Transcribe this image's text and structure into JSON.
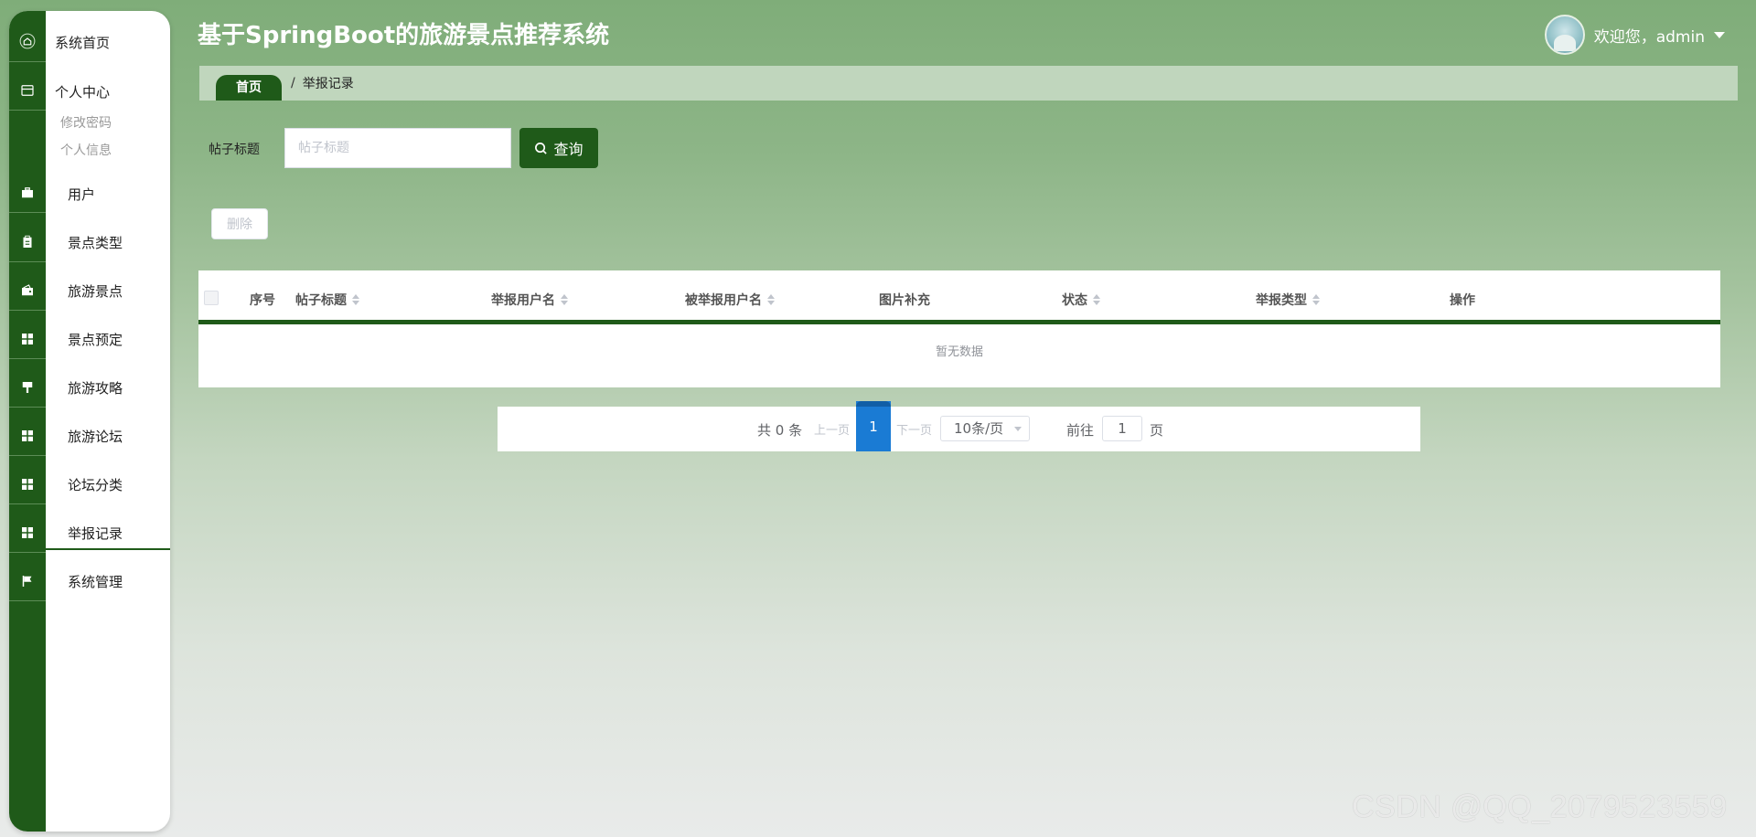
{
  "header": {
    "title": "基于SpringBoot的旅游景点推荐系统",
    "user_greeting": "欢迎您，admin"
  },
  "sidebar": {
    "items": [
      {
        "label": "系统首页",
        "icon": "home-icon"
      },
      {
        "label": "个人中心",
        "icon": "card-icon"
      },
      {
        "label": "修改密码"
      },
      {
        "label": "个人信息"
      },
      {
        "label": "用户",
        "icon": "briefcase-icon"
      },
      {
        "label": "景点类型",
        "icon": "clipboard-icon"
      },
      {
        "label": "旅游景点",
        "icon": "wallet-icon"
      },
      {
        "label": "景点预定",
        "icon": "grid-icon"
      },
      {
        "label": "旅游攻略",
        "icon": "brush-icon"
      },
      {
        "label": "旅游论坛",
        "icon": "grid-icon"
      },
      {
        "label": "论坛分类",
        "icon": "grid-icon"
      },
      {
        "label": "举报记录",
        "icon": "grid-icon"
      },
      {
        "label": "系统管理",
        "icon": "flag-icon"
      }
    ]
  },
  "breadcrumb": {
    "home": "首页",
    "separator": "/",
    "current": "举报记录"
  },
  "search": {
    "label": "帖子标题",
    "placeholder": "帖子标题",
    "value": "",
    "button": "查询"
  },
  "actions": {
    "delete": "删除"
  },
  "table": {
    "columns": [
      "序号",
      "帖子标题",
      "举报用户名",
      "被举报用户名",
      "图片补充",
      "状态",
      "举报类型",
      "操作"
    ],
    "rows": [],
    "empty_text": "暂无数据"
  },
  "pagination": {
    "total": "共 0 条",
    "prev": "上一页",
    "current_page": "1",
    "next": "下一页",
    "page_size": "10条/页",
    "goto_label": "前往",
    "goto_value": "1",
    "goto_suffix": "页"
  },
  "watermark": "CSDN @QQ_2079523559",
  "colors": {
    "primary": "#1f5a19",
    "page_active": "#1a7bd4"
  }
}
